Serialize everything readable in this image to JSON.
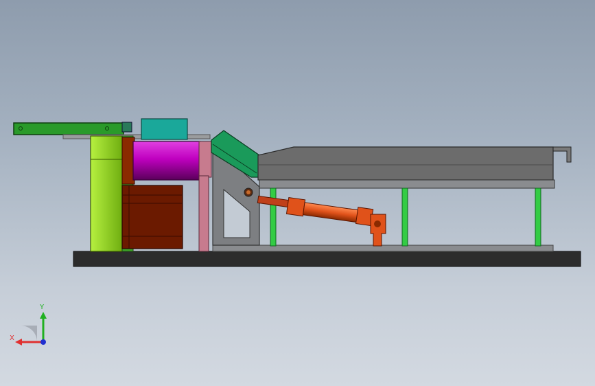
{
  "view": {
    "background_top": "#8e9cad",
    "background_bottom": "#d3d9e1"
  },
  "model_colors": {
    "base_plate": "#2c2c2c",
    "frame_gray": "#7d7f82",
    "tray": "#6c6c6c",
    "green_bracket": "#228b22",
    "lime_block": "#8fd01e",
    "teal_box": "#1aa89a",
    "magenta_roller": "#c000c0",
    "rust_motor": "#6b1a00",
    "pink_post": "#c77b8e",
    "chute_green": "#1a9a5a",
    "green_posts": "#33cc44",
    "cylinder_orange": "#e0521a"
  },
  "triad": {
    "x_label": "X",
    "y_label": "Y",
    "x_color": "#e03030",
    "y_color": "#20b020",
    "z_color": "#2030d0",
    "icon": "coordinate-triad-icon"
  }
}
